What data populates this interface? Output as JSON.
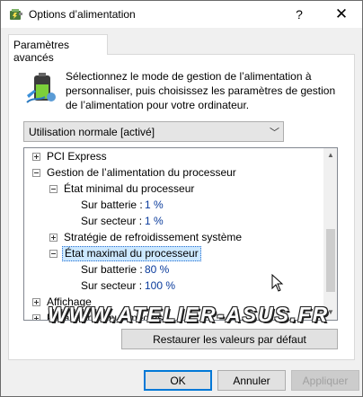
{
  "window": {
    "title": "Options d’alimentation",
    "help_glyph": "?",
    "close_glyph": "✕"
  },
  "tab": {
    "label": "Paramètres avancés"
  },
  "description": "Sélectionnez le mode de gestion de l’alimentation à personnaliser, puis choisissez les paramètres de gestion de l’alimentation pour votre ordinateur.",
  "plan_select": {
    "value": "Utilisation normale [activé]"
  },
  "tree": {
    "pci": "PCI Express",
    "cpu_mgmt": "Gestion de l’alimentation du processeur",
    "min_state": "État minimal du processeur",
    "min_battery_label": "Sur batterie :",
    "min_battery_value": "1  %",
    "min_ac_label": "Sur secteur :",
    "min_ac_value": "1  %",
    "cooling": "Stratégie de refroidissement système",
    "max_state": "État maximal du processeur",
    "max_battery_label": "Sur batterie :",
    "max_battery_value": "80  %",
    "max_ac_label": "Sur secteur :",
    "max_ac_value": "100  %",
    "display": "Affichage",
    "multimedia": "Paramètres multimédias"
  },
  "watermark": "WWW.ATELIER-ASUS.FR",
  "buttons": {
    "restore": "Restaurer les valeurs par défaut",
    "ok": "OK",
    "cancel": "Annuler",
    "apply": "Appliquer"
  }
}
